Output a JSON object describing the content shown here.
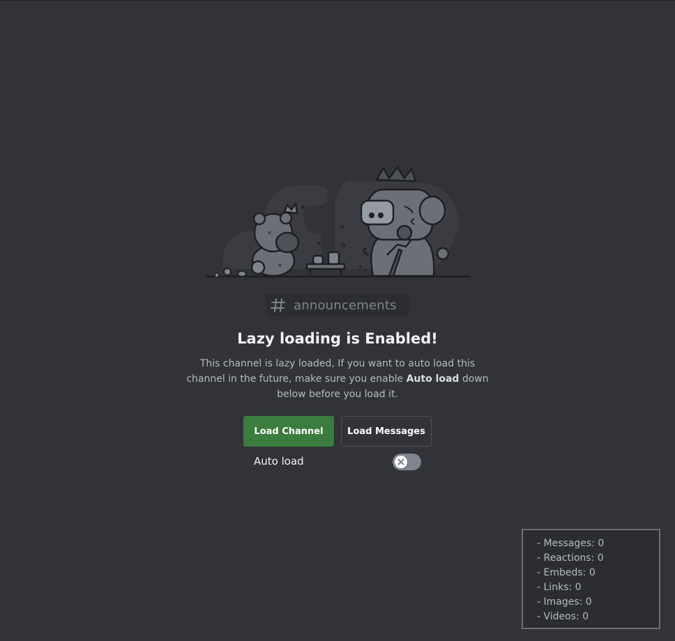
{
  "channel": {
    "name": "announcements",
    "icon": "hash-icon"
  },
  "lazy_notice": {
    "title": "Lazy loading is Enabled!",
    "description_part1": "This channel is lazy loaded, If you want to auto load this channel in the future, make sure you enable ",
    "description_bold": "Auto load",
    "description_part2": " down below before you load it."
  },
  "actions": {
    "load_channel_label": "Load Channel",
    "load_messages_label": "Load Messages",
    "load_channel_color": "#3b7c3f"
  },
  "auto_load": {
    "label": "Auto load",
    "enabled": false,
    "toggle_icon": "x-icon"
  },
  "stats": {
    "messages": "- Messages: 0",
    "reactions": "- Reactions: 0",
    "embeds": "- Embeds: 0",
    "links": "- Links: 0",
    "images": "- Images: 0",
    "videos": "- Videos: 0"
  },
  "colors": {
    "background": "#313338",
    "text_primary": "#f2f3f5",
    "text_muted": "#b5bac1"
  }
}
